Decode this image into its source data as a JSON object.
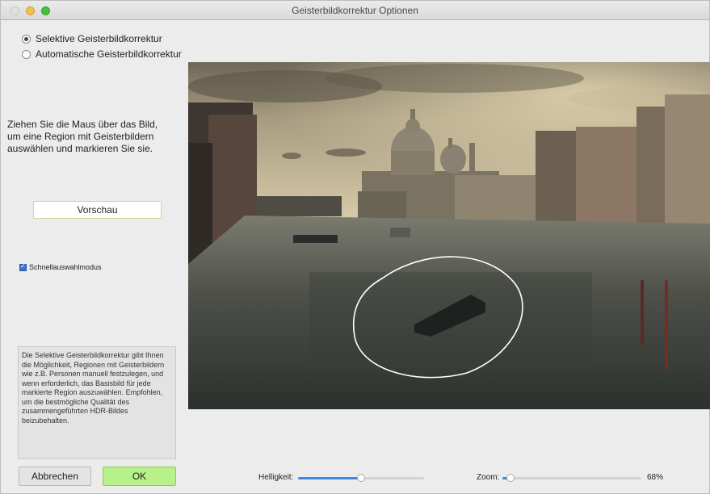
{
  "window": {
    "title": "Geisterbildkorrektur Optionen"
  },
  "mode": {
    "options": [
      {
        "label": "Selektive Geisterbildkorrektur",
        "selected": true
      },
      {
        "label": "Automatische Geisterbildkorrektur",
        "selected": false
      }
    ]
  },
  "instruction": {
    "lines": [
      "Ziehen Sie die Maus über das Bild,",
      "um eine Region mit Geisterbildern",
      "auswählen und markieren Sie sie."
    ]
  },
  "preview_button": "Vorschau",
  "quick_select": {
    "label": "Schnellauswahlmodus",
    "checked": true
  },
  "info": {
    "lines": [
      "Die Selektive Geisterbildkorrektur gibt Ihnen",
      "die Möglichkeit, Regionen mit Geisterbildern",
      "wie z.B. Personen manuell festzulegen, und",
      "wenn erforderlich, das Basisbild für jede",
      "markierte Region auszuwählen. Empfohlen,",
      "um die bestmögliche Qualität des",
      "zusammengeführten HDR-Bildes",
      "beizubehalten."
    ]
  },
  "buttons": {
    "cancel": "Abbrechen",
    "ok": "OK"
  },
  "brightness": {
    "label": "Helligkeit:",
    "value": 0.5
  },
  "zoom": {
    "label": "Zoom:",
    "value": 0.06,
    "display": "68%"
  },
  "colors": {
    "accent": "#3c8be0",
    "ok_button": "#b8f08a"
  }
}
